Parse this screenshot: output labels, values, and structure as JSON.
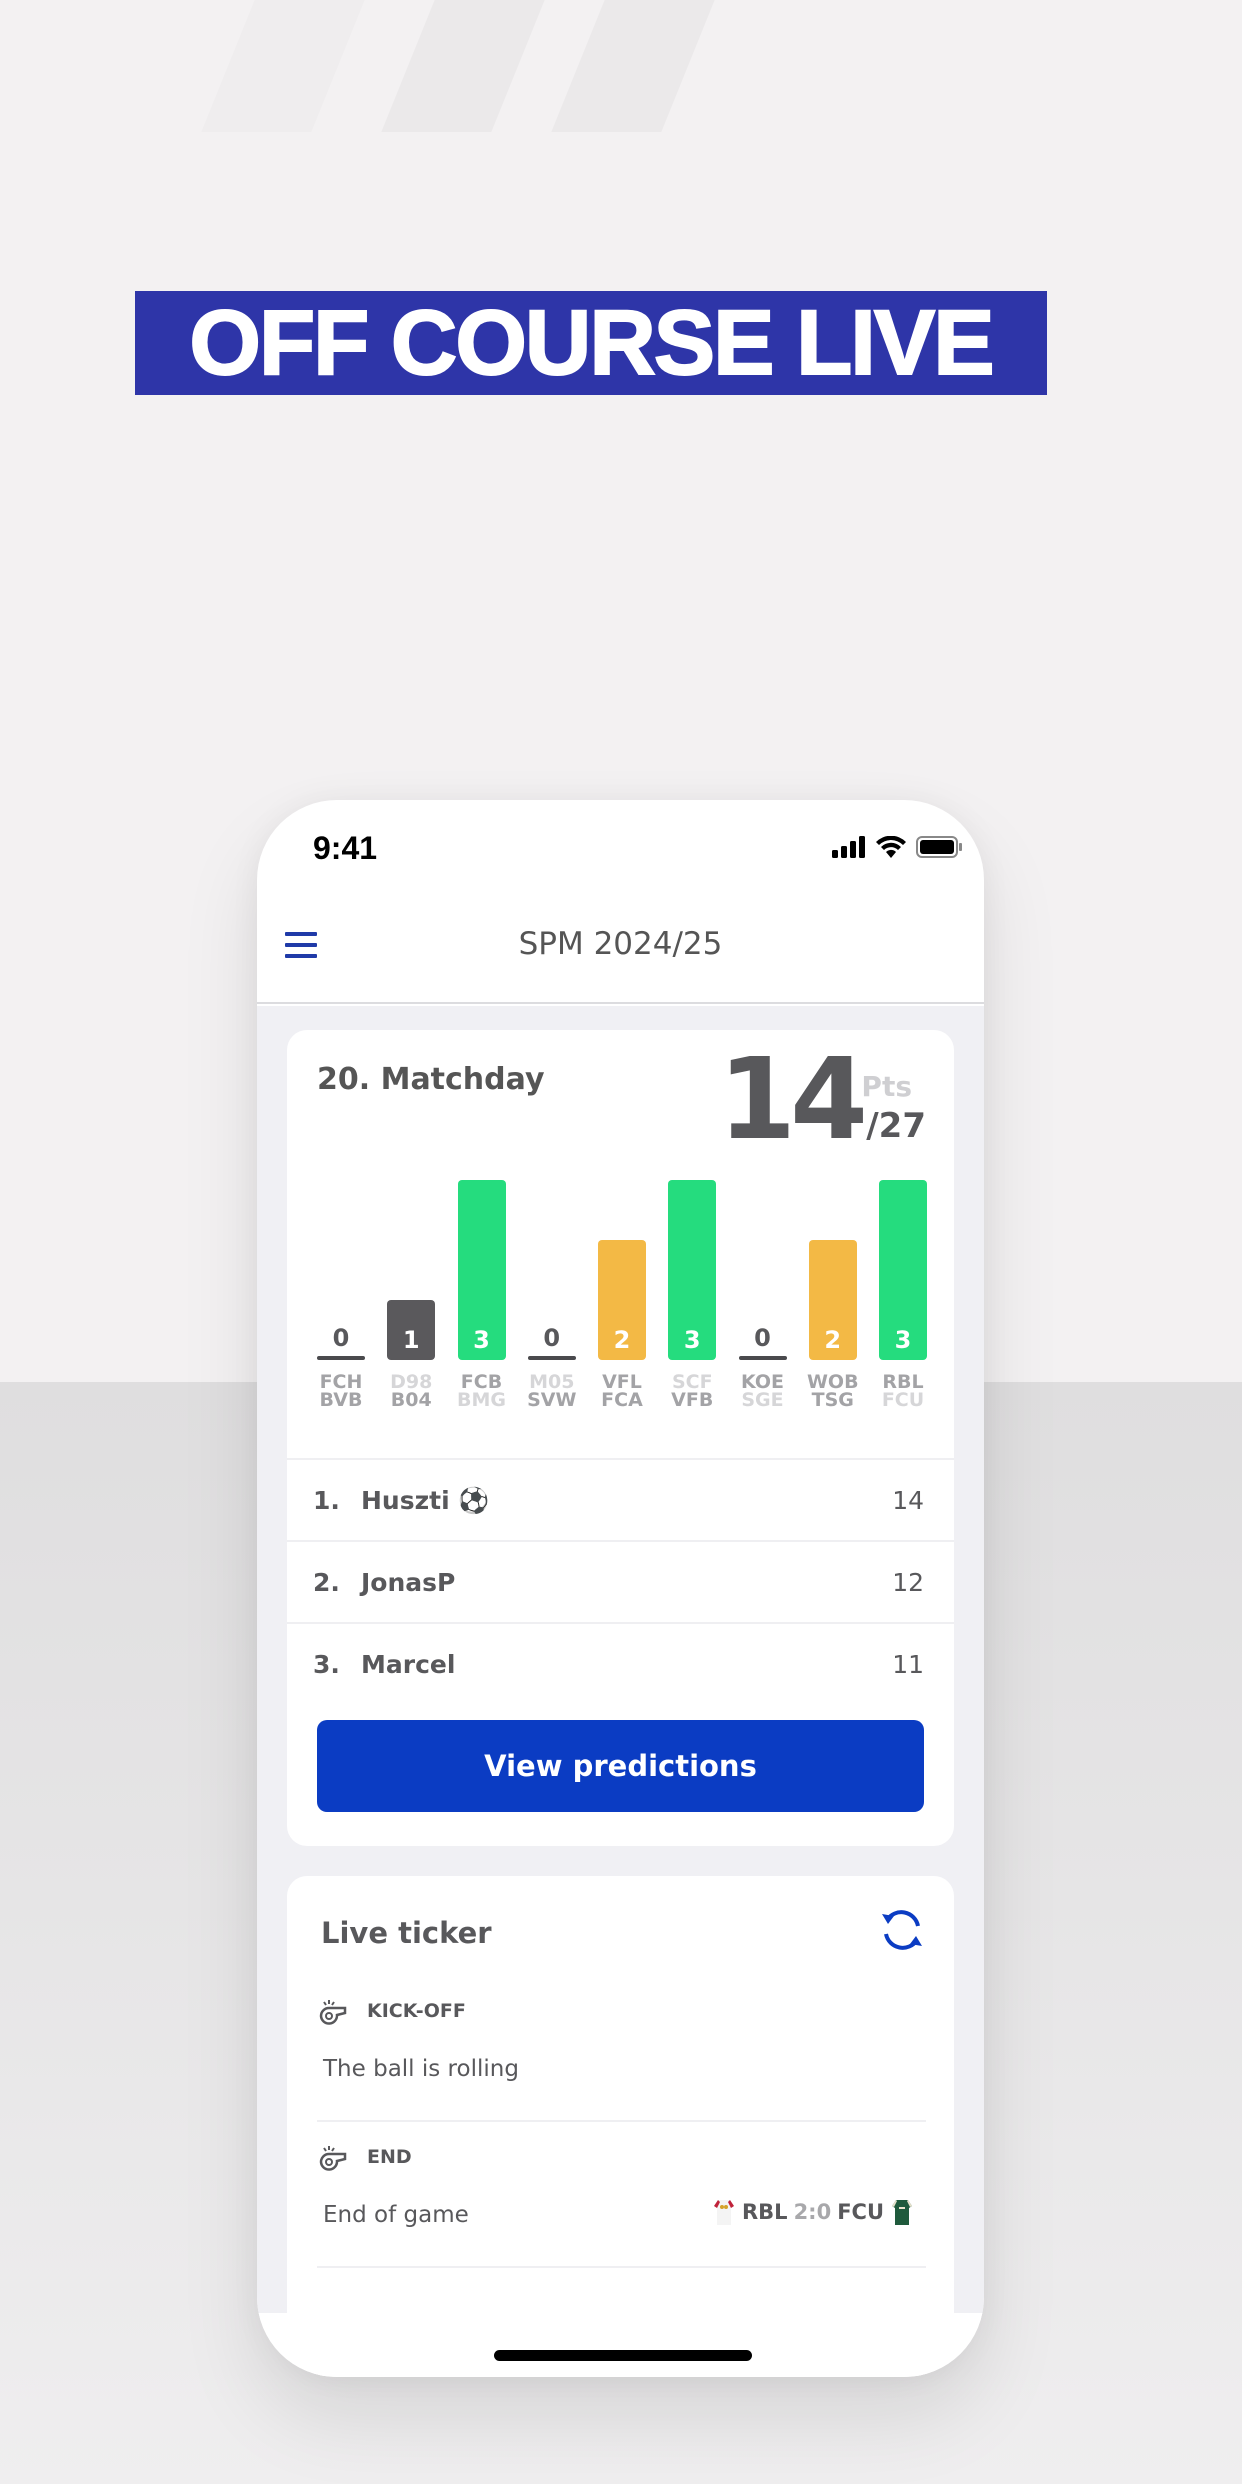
{
  "brand": {
    "title": "OFF COURSE LIVE"
  },
  "status_bar": {
    "time": "9:41",
    "icons": [
      "signal-icon",
      "wifi-icon",
      "battery-icon"
    ]
  },
  "navbar": {
    "title": "SPM 2024/25",
    "menu_icon": "hamburger-menu-icon"
  },
  "matchday": {
    "title": "20. Matchday",
    "points": "14",
    "points_label": "Pts",
    "points_max": "/27"
  },
  "chart_data": {
    "type": "bar",
    "title": "20. Matchday",
    "categories": [
      "FCH-BVB",
      "D98-B04",
      "FCB-BMG",
      "M05-SVW",
      "VFL-FCA",
      "SCF-VFB",
      "KOE-SGE",
      "WOB-TSG",
      "RBL-FCU"
    ],
    "values": [
      0,
      1,
      3,
      0,
      2,
      3,
      0,
      2,
      3
    ],
    "ylim": [
      0,
      3
    ],
    "matches": [
      {
        "home": "FCH",
        "away": "BVB",
        "points": 0,
        "home_bold": true,
        "away_bold": true
      },
      {
        "home": "D98",
        "away": "B04",
        "points": 1,
        "home_bold": false,
        "away_bold": true
      },
      {
        "home": "FCB",
        "away": "BMG",
        "points": 3,
        "home_bold": true,
        "away_bold": false
      },
      {
        "home": "M05",
        "away": "SVW",
        "points": 0,
        "home_bold": false,
        "away_bold": true
      },
      {
        "home": "VFL",
        "away": "FCA",
        "points": 2,
        "home_bold": true,
        "away_bold": true
      },
      {
        "home": "SCF",
        "away": "VFB",
        "points": 3,
        "home_bold": false,
        "away_bold": true
      },
      {
        "home": "KOE",
        "away": "SGE",
        "points": 0,
        "home_bold": true,
        "away_bold": false
      },
      {
        "home": "WOB",
        "away": "TSG",
        "points": 2,
        "home_bold": true,
        "away_bold": true
      },
      {
        "home": "RBL",
        "away": "FCU",
        "points": 3,
        "home_bold": true,
        "away_bold": false
      }
    ],
    "colors": {
      "1": "#5a595c",
      "2": "#f3b945",
      "3": "#25dc7e"
    }
  },
  "ranking": [
    {
      "rank": "1.",
      "name": "Huszti ⚽",
      "points": "14"
    },
    {
      "rank": "2.",
      "name": "JonasP",
      "points": "12"
    },
    {
      "rank": "3.",
      "name": "Marcel",
      "points": "11"
    }
  ],
  "view_predictions_label": "View predictions",
  "live_ticker": {
    "title": "Live ticker",
    "events": [
      {
        "type": "KICK-OFF",
        "text": "The ball is rolling",
        "icon": "whistle-icon"
      },
      {
        "type": "END",
        "text": "End of game",
        "icon": "whistle-icon",
        "home": "RBL",
        "score": "2:0",
        "away": "FCU"
      }
    ]
  },
  "colors": {
    "accent": "#0b3cc3",
    "brand_bg": "#2e35a8",
    "text": "#58585b"
  }
}
